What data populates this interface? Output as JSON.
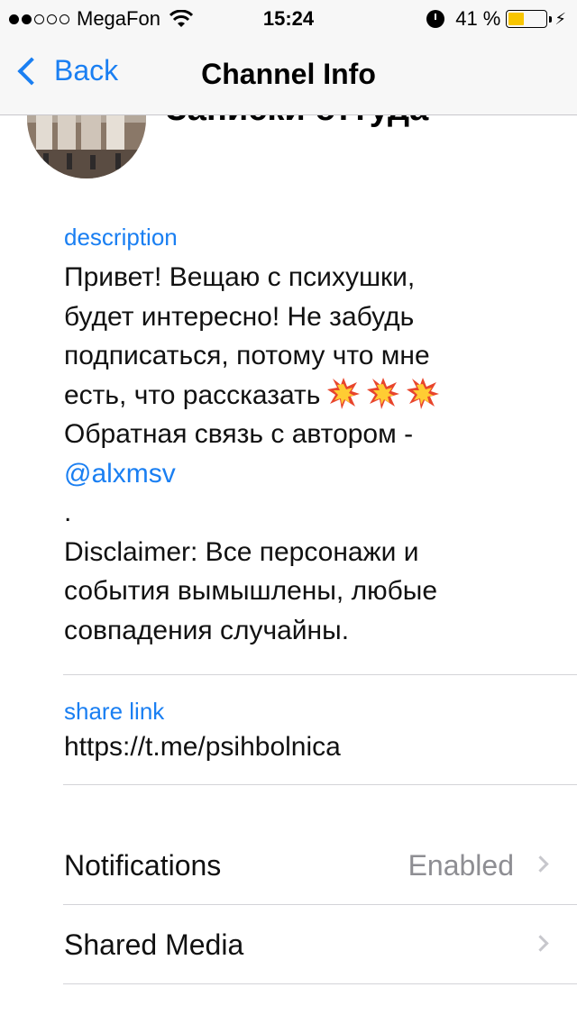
{
  "status_bar": {
    "signal_dots_filled": 2,
    "signal_dots_total": 5,
    "carrier": "MegaFon",
    "time": "15:24",
    "battery_percent": "41 %",
    "battery_level": 0.41,
    "battery_color": "#f7c500"
  },
  "nav": {
    "back_label": "Back",
    "title": "Channel Info"
  },
  "channel": {
    "name": "Записки оттуда"
  },
  "description": {
    "label": "description",
    "lines": [
      "Привет! Вещаю с психушки,",
      "будет интересно! Не забудь",
      "подписаться, потому что мне",
      "есть, что рассказать",
      "Обратная связь с автором -",
      "@alxmsv",
      ".",
      "Disclaimer: Все персонажи и",
      "события вымышлены, любые",
      "совпадения случайны."
    ],
    "emoji": [
      "collision-emoji",
      "collision-emoji",
      "collision-emoji"
    ]
  },
  "share_link": {
    "label": "share link",
    "value": "https://t.me/psihbolnica"
  },
  "settings": {
    "notifications_label": "Notifications",
    "notifications_value": "Enabled",
    "shared_media_label": "Shared Media"
  },
  "colors": {
    "accent": "#1a7ff2",
    "secondary_text": "#8e8e93",
    "bar_background": "#f7f7f7"
  }
}
